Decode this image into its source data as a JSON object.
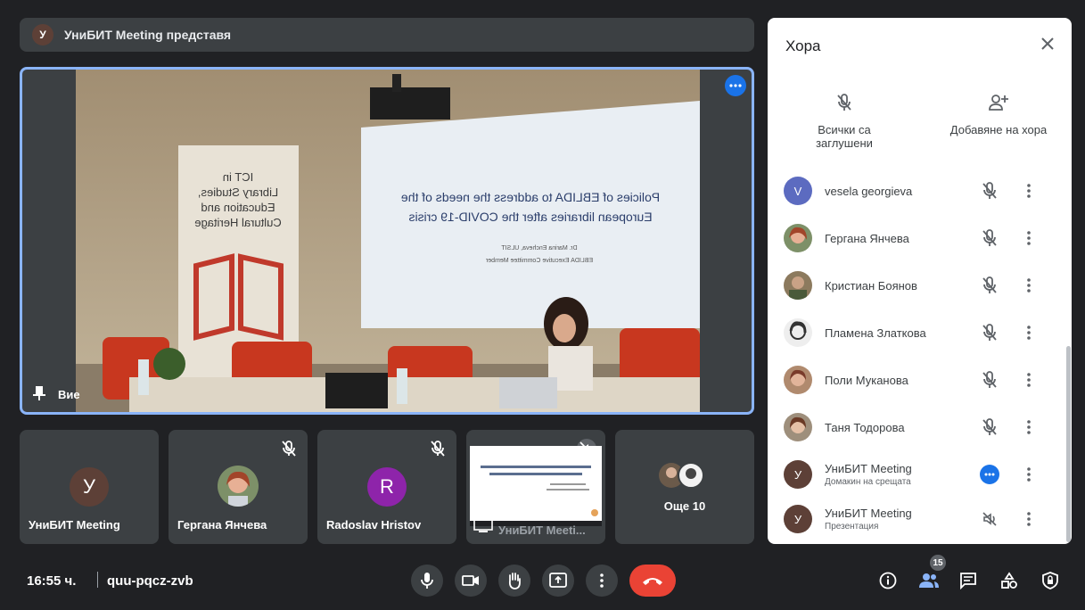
{
  "banner": {
    "avatar_letter": "У",
    "text": "УниБИТ Meeting представя"
  },
  "main": {
    "you_label": "Вие",
    "slide": {
      "line1": "Policies of EBLIDA to address the needs of the",
      "line2": "European libraries after the COVID-19 crisis",
      "author": "Dr. Marina Encheva, ULSIT",
      "role": "EBLIDA Executive Committee Member"
    },
    "banner_sign": {
      "l1": "ICT in",
      "l2": "Library Studies,",
      "l3": "Education and",
      "l4": "Cultural Heritage"
    }
  },
  "thumbs": [
    {
      "name": "УниБИТ Meeting",
      "avatar_letter": "У",
      "avatar_color": "#5d4037"
    },
    {
      "name": "Гергана Янчева"
    },
    {
      "name": "Radoslav Hristov",
      "avatar_letter": "R",
      "avatar_color": "#8e24aa"
    },
    {
      "name": "УниБИТ Meeti..."
    },
    {
      "name": "Още 10"
    }
  ],
  "bottom": {
    "time": "16:55 ч.",
    "code": "quu-pqcz-zvb",
    "people_count": "15"
  },
  "panel": {
    "title": "Хора",
    "actions": [
      {
        "label": "Всички са заглушени",
        "icon": "mic-off-icon"
      },
      {
        "label": "Добавяне на хора",
        "icon": "add-person-icon"
      }
    ],
    "people": [
      {
        "name": "vesela georgieva",
        "avatar_letter": "V",
        "avatar_color": "#5c6bc0"
      },
      {
        "name": "Гергана Янчева"
      },
      {
        "name": "Кристиан Боянов"
      },
      {
        "name": "Пламена Златкова"
      },
      {
        "name": "Поли Муканова"
      },
      {
        "name": "Таня Тодорова"
      },
      {
        "name": "УниБИТ Meeting",
        "sub": "Домакин на срещата",
        "avatar_letter": "У",
        "avatar_color": "#5d4037"
      },
      {
        "name": "УниБИТ Meeting",
        "sub": "Презентация",
        "avatar_letter": "У",
        "avatar_color": "#5d4037"
      }
    ]
  }
}
